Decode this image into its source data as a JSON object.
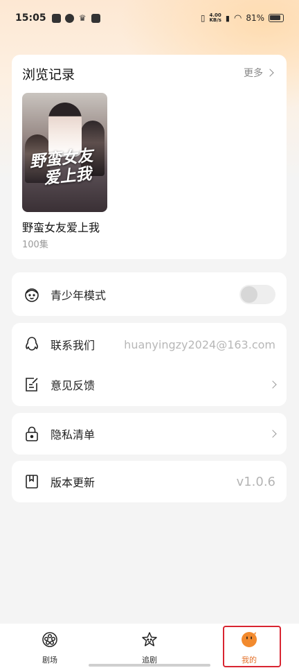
{
  "status_bar": {
    "time": "15:05",
    "network": "4.00\nKB/s",
    "battery": "81%"
  },
  "history": {
    "title": "浏览记录",
    "more_label": "更多",
    "item": {
      "name": "野蛮女友爱上我",
      "episodes": "100集",
      "poster_title_line1": "野蛮女友",
      "poster_title_line2": "爱上我"
    }
  },
  "settings": {
    "youth_mode": {
      "label": "青少年模式",
      "enabled": false
    },
    "contact": {
      "label": "联系我们",
      "value": "huanyingzy2024@163.com"
    },
    "feedback": {
      "label": "意见反馈"
    },
    "privacy": {
      "label": "隐私清单"
    },
    "update": {
      "label": "版本更新",
      "value": "v1.0.6"
    }
  },
  "tab_bar": {
    "tabs": [
      {
        "label": "剧场",
        "icon": "film-reel-icon",
        "active": false
      },
      {
        "label": "追剧",
        "icon": "star-icon",
        "active": false
      },
      {
        "label": "我的",
        "icon": "mascot-icon",
        "active": true
      }
    ]
  },
  "colors": {
    "accent": "#e3712a",
    "highlight_box": "#d82430",
    "background": "#f4f4f4"
  }
}
